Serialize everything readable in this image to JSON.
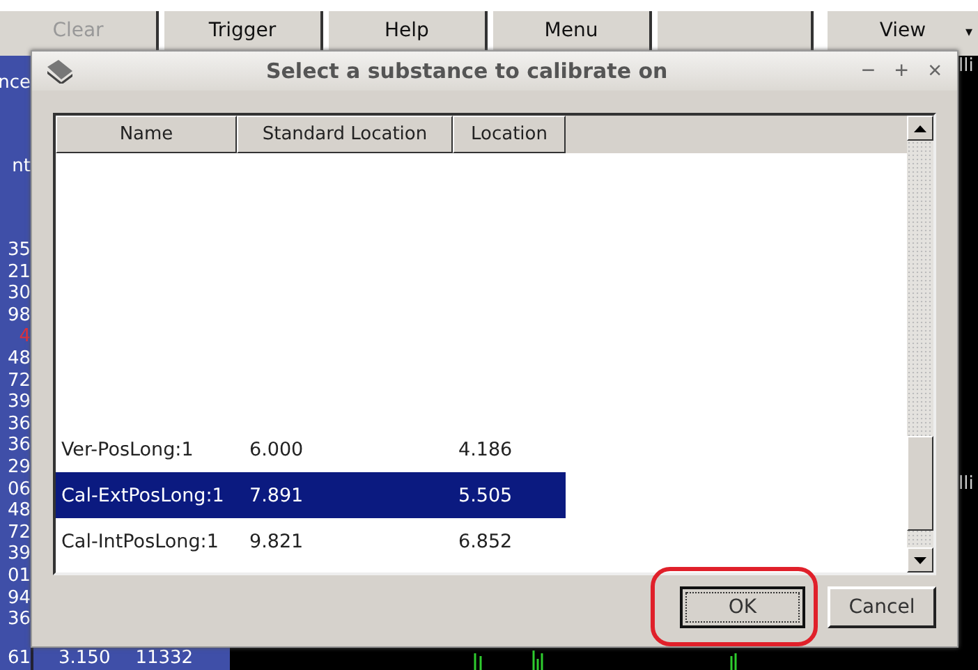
{
  "toolbar": {
    "buttons": [
      {
        "label": "Clear",
        "disabled": true
      },
      {
        "label": "Trigger",
        "disabled": false
      },
      {
        "label": "Help",
        "disabled": false
      },
      {
        "label": "Menu",
        "disabled": false
      },
      {
        "label": "View",
        "disabled": false
      }
    ],
    "view_caret": "▾"
  },
  "left_panel": {
    "headers": [
      "nce",
      "nt"
    ],
    "values": [
      {
        "text": "35",
        "alert": false
      },
      {
        "text": "21",
        "alert": false
      },
      {
        "text": "30",
        "alert": false
      },
      {
        "text": "98",
        "alert": false
      },
      {
        "text": "4",
        "alert": true
      },
      {
        "text": "48",
        "alert": false
      },
      {
        "text": "72",
        "alert": false
      },
      {
        "text": "39",
        "alert": false
      },
      {
        "text": "36",
        "alert": false
      },
      {
        "text": "36",
        "alert": false
      },
      {
        "text": "29",
        "alert": false
      },
      {
        "text": "06",
        "alert": false
      },
      {
        "text": "48",
        "alert": false
      },
      {
        "text": "72",
        "alert": false
      },
      {
        "text": "39",
        "alert": false
      },
      {
        "text": "01",
        "alert": false
      },
      {
        "text": "94",
        "alert": false
      },
      {
        "text": "36",
        "alert": false
      }
    ]
  },
  "right_panel": {
    "labels": [
      "lli",
      "lli"
    ]
  },
  "bottom_row": {
    "cells": [
      "61",
      "3.150",
      "11332"
    ]
  },
  "dialog": {
    "title": "Select a substance to calibrate on",
    "controls": [
      "−",
      "+",
      "×"
    ],
    "table": {
      "columns": [
        "Name",
        "Standard Location",
        "Location"
      ],
      "rows": [
        {
          "name": "Ver-PosLong:1",
          "standard_location": "6.000",
          "location": "4.186",
          "selected": false
        },
        {
          "name": "Cal-ExtPosLong:1",
          "standard_location": "7.891",
          "location": "5.505",
          "selected": true
        },
        {
          "name": "Cal-IntPosLong:1",
          "standard_location": "9.821",
          "location": "6.852",
          "selected": false
        }
      ]
    },
    "buttons": [
      {
        "label": "OK",
        "focused": true,
        "highlighted": true
      },
      {
        "label": "Cancel",
        "focused": false,
        "highlighted": false
      }
    ]
  }
}
